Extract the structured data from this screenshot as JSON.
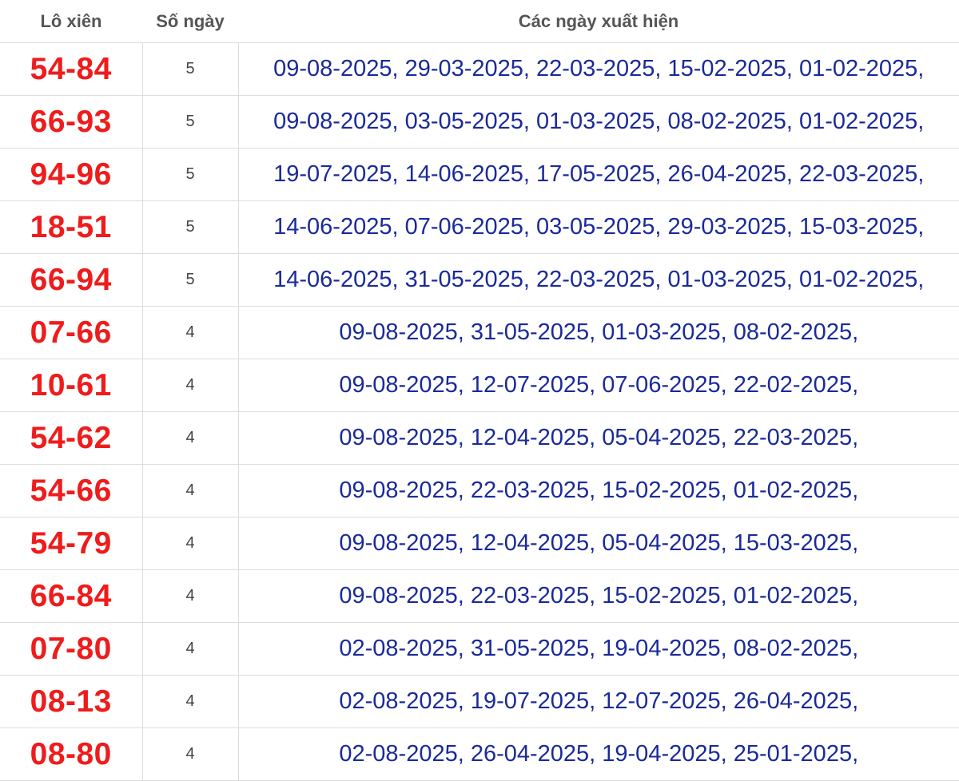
{
  "headers": {
    "pair": "Lô xiên",
    "days": "Số ngày",
    "dates": "Các ngày xuất hiện"
  },
  "rows": [
    {
      "pair": "54-84",
      "days": "5",
      "dates": "09-08-2025, 29-03-2025, 22-03-2025, 15-02-2025, 01-02-2025,"
    },
    {
      "pair": "66-93",
      "days": "5",
      "dates": "09-08-2025, 03-05-2025, 01-03-2025, 08-02-2025, 01-02-2025,"
    },
    {
      "pair": "94-96",
      "days": "5",
      "dates": "19-07-2025, 14-06-2025, 17-05-2025, 26-04-2025, 22-03-2025,"
    },
    {
      "pair": "18-51",
      "days": "5",
      "dates": "14-06-2025, 07-06-2025, 03-05-2025, 29-03-2025, 15-03-2025,"
    },
    {
      "pair": "66-94",
      "days": "5",
      "dates": "14-06-2025, 31-05-2025, 22-03-2025, 01-03-2025, 01-02-2025,"
    },
    {
      "pair": "07-66",
      "days": "4",
      "dates": "09-08-2025, 31-05-2025, 01-03-2025, 08-02-2025,"
    },
    {
      "pair": "10-61",
      "days": "4",
      "dates": "09-08-2025, 12-07-2025, 07-06-2025, 22-02-2025,"
    },
    {
      "pair": "54-62",
      "days": "4",
      "dates": "09-08-2025, 12-04-2025, 05-04-2025, 22-03-2025,"
    },
    {
      "pair": "54-66",
      "days": "4",
      "dates": "09-08-2025, 22-03-2025, 15-02-2025, 01-02-2025,"
    },
    {
      "pair": "54-79",
      "days": "4",
      "dates": "09-08-2025, 12-04-2025, 05-04-2025, 15-03-2025,"
    },
    {
      "pair": "66-84",
      "days": "4",
      "dates": "09-08-2025, 22-03-2025, 15-02-2025, 01-02-2025,"
    },
    {
      "pair": "07-80",
      "days": "4",
      "dates": "02-08-2025, 31-05-2025, 19-04-2025, 08-02-2025,"
    },
    {
      "pair": "08-13",
      "days": "4",
      "dates": "02-08-2025, 19-07-2025, 12-07-2025, 26-04-2025,"
    },
    {
      "pair": "08-80",
      "days": "4",
      "dates": "02-08-2025, 26-04-2025, 19-04-2025, 25-01-2025,"
    }
  ],
  "colors": {
    "pair": "#ee1c1c",
    "dates": "#1a2a9a",
    "header": "#555555",
    "border": "#dddddd"
  }
}
